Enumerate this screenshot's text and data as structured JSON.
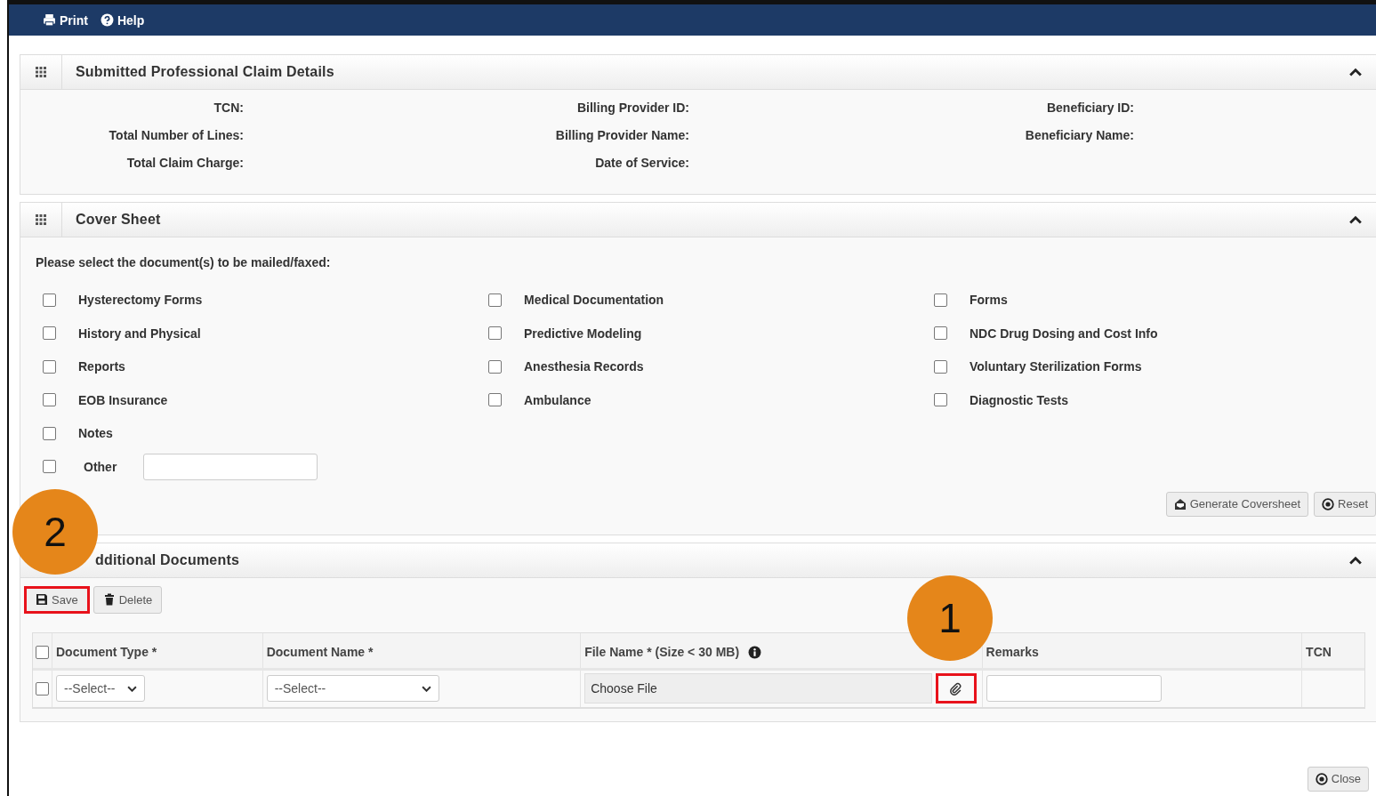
{
  "toolbar": [
    {
      "kind": "print",
      "label": "Print"
    },
    {
      "kind": "help",
      "label": "Help"
    }
  ],
  "claim_panel": {
    "title": "Submitted Professional Claim Details",
    "expanded": true,
    "field_columns": [
      [
        "TCN:",
        "Total Number of Lines:",
        "Total Claim Charge:"
      ],
      [
        "Billing Provider ID:",
        "Billing Provider Name:",
        "Date of Service:"
      ],
      [
        "Beneficiary ID:",
        "Beneficiary Name:"
      ]
    ]
  },
  "cover_sheet": {
    "title": "Cover Sheet",
    "expanded": true,
    "instruction": "Please select the document(s) to be mailed/faxed:",
    "columns": [
      [
        {
          "label": "Hysterectomy Forms",
          "checked": false
        },
        {
          "label": "History and Physical",
          "checked": false
        },
        {
          "label": "Reports",
          "checked": false
        },
        {
          "label": "EOB Insurance",
          "checked": false
        },
        {
          "label": "Notes",
          "checked": false
        }
      ],
      [
        {
          "label": "Medical Documentation",
          "checked": false
        },
        {
          "label": "Predictive Modeling",
          "checked": false
        },
        {
          "label": "Anesthesia Records",
          "checked": false
        },
        {
          "label": "Ambulance",
          "checked": false
        }
      ],
      [
        {
          "label": "Forms",
          "checked": false
        },
        {
          "label": "NDC Drug Dosing and Cost Info",
          "checked": false
        },
        {
          "label": "Voluntary Sterilization Forms",
          "checked": false
        },
        {
          "label": "Diagnostic Tests",
          "checked": false
        }
      ]
    ],
    "other": {
      "label": "Other",
      "checked": false
    },
    "buttons": [
      {
        "kind": "generate",
        "label": "Generate Coversheet"
      },
      {
        "kind": "reset",
        "label": "Reset"
      }
    ]
  },
  "additional_documents": {
    "title": "dditional Documents",
    "expanded": true,
    "buttons": [
      {
        "kind": "save",
        "label": "Save",
        "highlighted": true
      },
      {
        "kind": "delete",
        "label": "Delete",
        "highlighted": false
      }
    ],
    "columns": [
      "Document Type *",
      "Document Name *",
      "File Name * (Size < 30 MB)",
      "Remarks",
      "TCN"
    ],
    "header_checked": false,
    "row": {
      "checked": false,
      "document_type": "--Select--",
      "document_name": "--Select--",
      "file": "Choose File",
      "attach_highlighted": true
    }
  },
  "callouts": [
    {
      "label": "2"
    },
    {
      "label": "1"
    }
  ],
  "close_button": "Close"
}
